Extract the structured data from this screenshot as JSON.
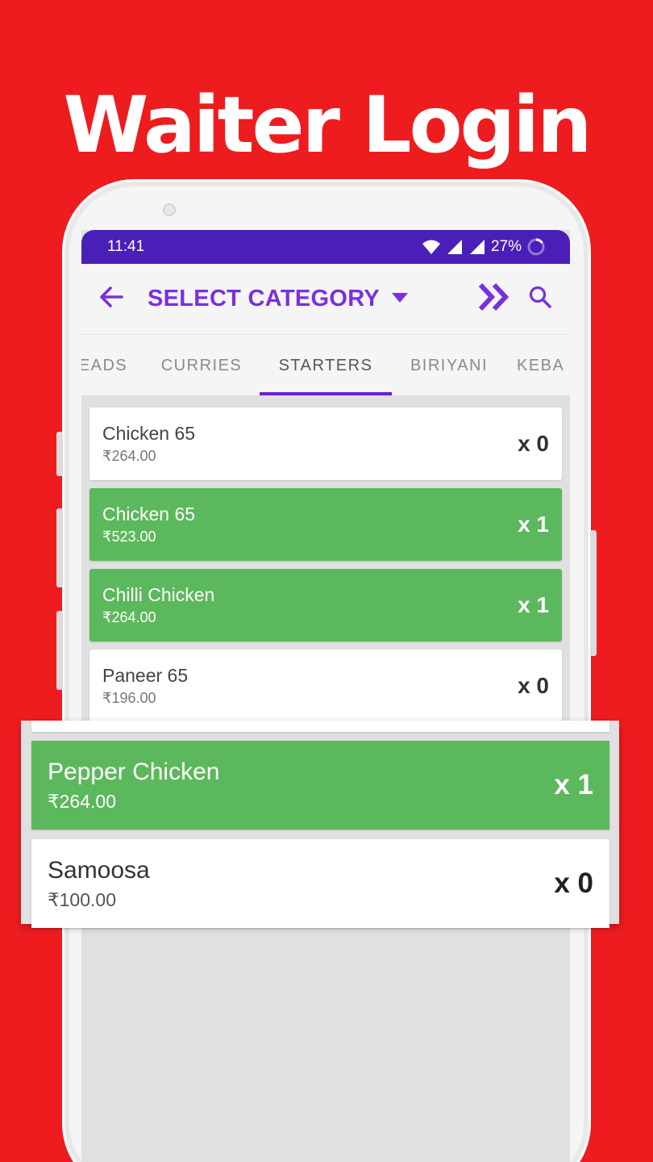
{
  "headline": "Waiter Login",
  "colors": {
    "background": "#ee1c1f",
    "accent": "#7a2fe0",
    "statusbar": "#4a1fb8",
    "selected": "#5cb85c"
  },
  "status": {
    "time": "11:41",
    "battery": "27%"
  },
  "appbar": {
    "back_icon": "arrow-left-icon",
    "title": "SELECT CATEGORY",
    "fast_forward_icon": "double-chevron-right-icon",
    "search_icon": "search-icon"
  },
  "tabs": [
    {
      "label": "EADS",
      "active": false
    },
    {
      "label": "CURRIES",
      "active": false
    },
    {
      "label": "STARTERS",
      "active": true
    },
    {
      "label": "BIRIYANI",
      "active": false
    },
    {
      "label": "KEBA",
      "active": false
    }
  ],
  "items": [
    {
      "name": "Chicken 65",
      "price": "₹264.00",
      "qty": "x 0",
      "selected": false
    },
    {
      "name": "Chicken 65",
      "price": "₹523.00",
      "qty": "x 1",
      "selected": true
    },
    {
      "name": "Chilli Chicken",
      "price": "₹264.00",
      "qty": "x 1",
      "selected": true
    },
    {
      "name": "Paneer 65",
      "price": "₹196.00",
      "qty": "x 0",
      "selected": false
    }
  ],
  "zoomed_items": [
    {
      "name": "Pepper Chicken",
      "price": "₹264.00",
      "qty": "x 1",
      "selected": true
    },
    {
      "name": "Samoosa",
      "price": "₹100.00",
      "qty": "x 0",
      "selected": false
    }
  ]
}
